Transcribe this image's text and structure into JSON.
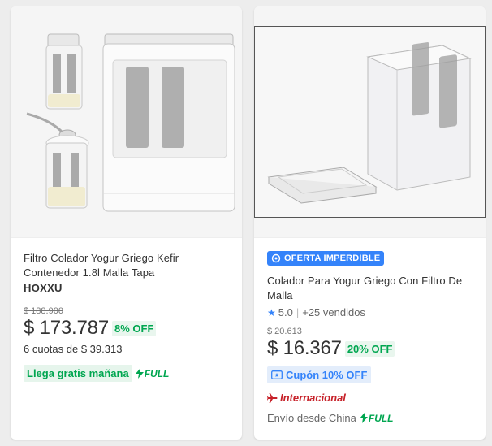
{
  "products": [
    {
      "image_alt": "Filtro colador de yogur griego",
      "title": "Filtro Colador Yogur Griego Kefir Contenedor 1.8l Malla Tapa",
      "brand": "HOXXU",
      "old_price": "$ 188.900",
      "price": "$ 173.787",
      "discount": "8% OFF",
      "installments": "6 cuotas de $ 39.313",
      "shipping": "Llega gratis mañana",
      "full_label": "FULL"
    },
    {
      "promo_badge": "OFERTA IMPERDIBLE",
      "title": "Colador Para Yogur Griego Con Filtro De Malla",
      "rating": "5.0",
      "sold": "+25 vendidos",
      "old_price": "$ 20.613",
      "price": "$ 16.367",
      "discount": "20% OFF",
      "coupon": "Cupón 10% OFF",
      "international": "Internacional",
      "ships_from": "Envío desde China",
      "full_label": "FULL"
    }
  ],
  "colors": {
    "accent_blue": "#3483fa",
    "green": "#00a650",
    "red": "#c7222a"
  }
}
